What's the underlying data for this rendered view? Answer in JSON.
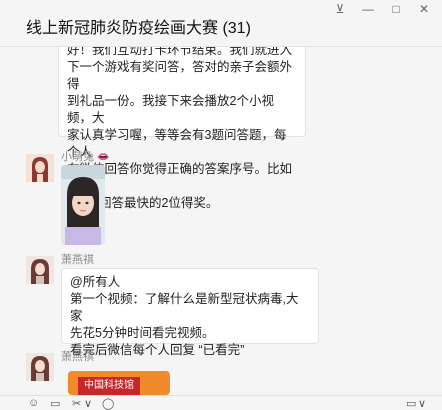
{
  "window": {
    "title": "线上新冠肺炎防疫绘画大赛 (31)",
    "controls": {
      "pin": "⊻",
      "minimize": "—",
      "maximize": "□",
      "close": "✕"
    }
  },
  "messages": [
    {
      "type": "text",
      "lines": [
        "好！我们互动打卡环节结束。我们就进入",
        "下一个游戏有奖问答，答对的亲子会额外得",
        "到礼品一份。我接下来会播放2个小视频，大",
        "家认真学习喔，等等会有3题问答题，每个人",
        "在微信回答你觉得正确的答案序号。比如1或",
        "者2，回答最快的2位得奖。"
      ]
    },
    {
      "type": "image",
      "sender": "小萌兔",
      "sender_emoji": "👄"
    },
    {
      "type": "text",
      "sender": "萧燕祺",
      "lines": [
        "@所有人",
        "第一个视频：了解什么是新型冠状病毒,大家",
        "先花5分钟时间看完视频。",
        "看完后微信每个人回复 “已看完”"
      ]
    },
    {
      "type": "image",
      "sender": "萧燕祺",
      "banner_text": "中国科技馆"
    }
  ],
  "toolbar": {
    "emoji": "☺",
    "file": "▭",
    "scissors": "✂",
    "scissors_arrow": "∨",
    "chat": "◯",
    "video": "▭",
    "video_arrow": "∨"
  },
  "colors": {
    "background": "#f5f5f5",
    "bubble": "#ffffff",
    "sender_name": "#8a8a8a"
  }
}
